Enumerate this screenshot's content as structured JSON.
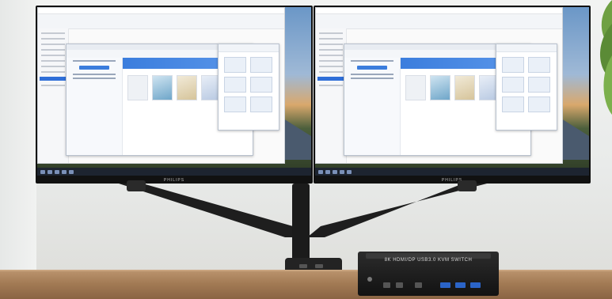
{
  "scene": {
    "description_icons": [
      "monitor-icon",
      "kvm-switch-icon",
      "monitor-arm-icon"
    ],
    "monitor_brand": "PHILIPS",
    "kvm_label": "8K HDMI/DP USB3.0 KVM SWITCH",
    "colors": {
      "accent_blue": "#3b7ddd",
      "usb_blue": "#2b64c7",
      "desk": "#a27a54",
      "device": "#1b1b1b"
    }
  }
}
